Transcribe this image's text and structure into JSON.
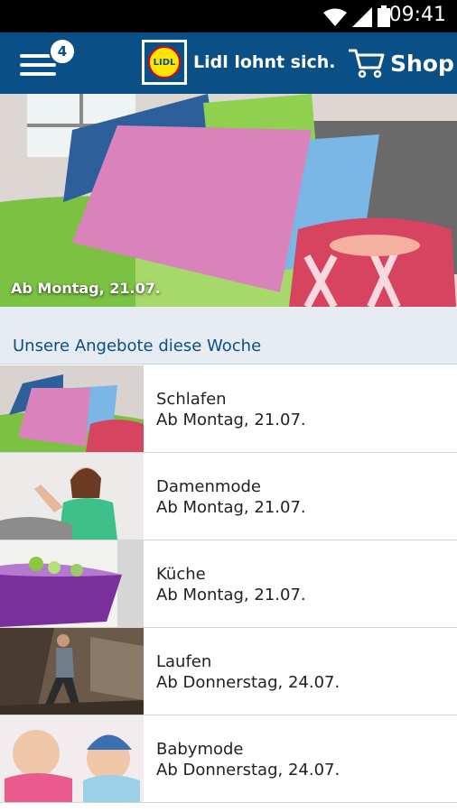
{
  "status_bar": {
    "time": "09:41",
    "icons": [
      "wifi-icon",
      "signal-icon",
      "battery-icon"
    ]
  },
  "app_bar": {
    "menu_badge": "4",
    "logo_text": "LIDL",
    "title": "Lidl lohnt sich.",
    "shop_label": "Shop",
    "background": "#0a4f85"
  },
  "hero": {
    "caption": "Ab Montag, 21.07."
  },
  "section": {
    "title": "Unsere Angebote diese Woche"
  },
  "offers": [
    {
      "title": "Schlafen",
      "date": "Ab Montag, 21.07."
    },
    {
      "title": "Damenmode",
      "date": "Ab Montag, 21.07."
    },
    {
      "title": "Küche",
      "date": "Ab Montag, 21.07."
    },
    {
      "title": "Laufen",
      "date": "Ab Donnerstag, 24.07."
    },
    {
      "title": "Babymode",
      "date": "Ab Donnerstag, 24.07."
    }
  ],
  "colors": {
    "brand_blue": "#0a4f85",
    "lidl_yellow": "#ffe500",
    "lidl_red": "#e2001a"
  }
}
